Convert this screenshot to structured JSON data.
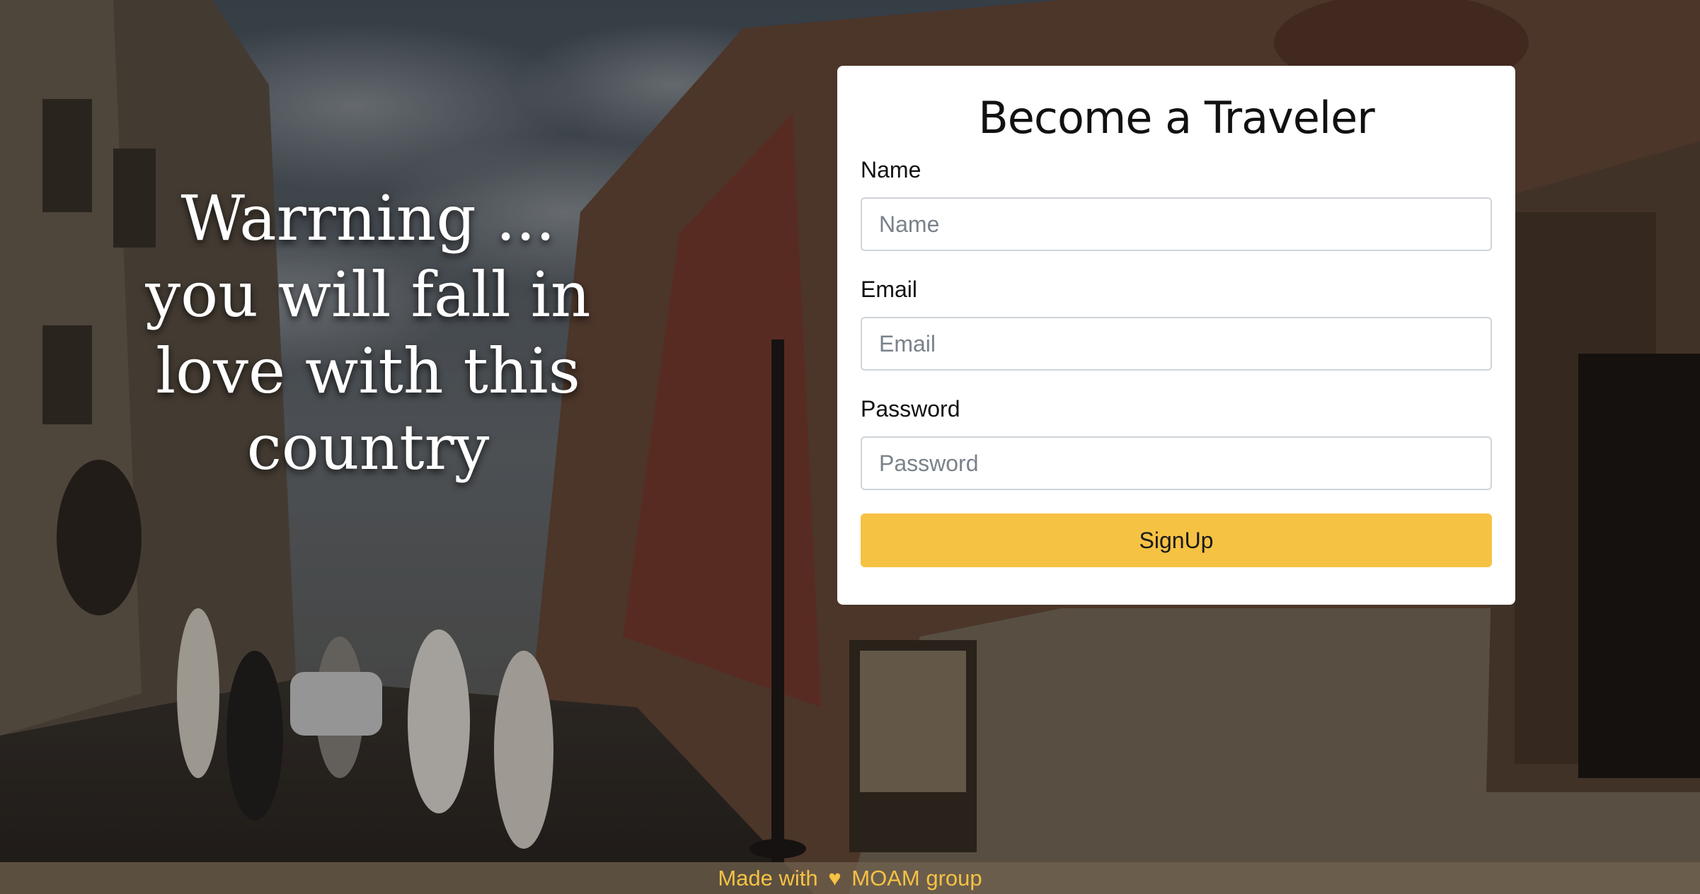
{
  "hero": {
    "lines": [
      "Warrning ...",
      "you will fall in",
      "love with this",
      "country"
    ]
  },
  "form": {
    "title": "Become a Traveler",
    "fields": [
      {
        "label": "Name",
        "placeholder": "Name"
      },
      {
        "label": "Email",
        "placeholder": "Email"
      },
      {
        "label": "Password",
        "placeholder": "Password"
      }
    ],
    "submit_label": "SignUp"
  },
  "footer": {
    "prefix": "Made with",
    "icon": "heart-icon",
    "suffix": "MOAM group"
  },
  "colors": {
    "accent": "#f6c244",
    "card_background": "#ffffff"
  }
}
